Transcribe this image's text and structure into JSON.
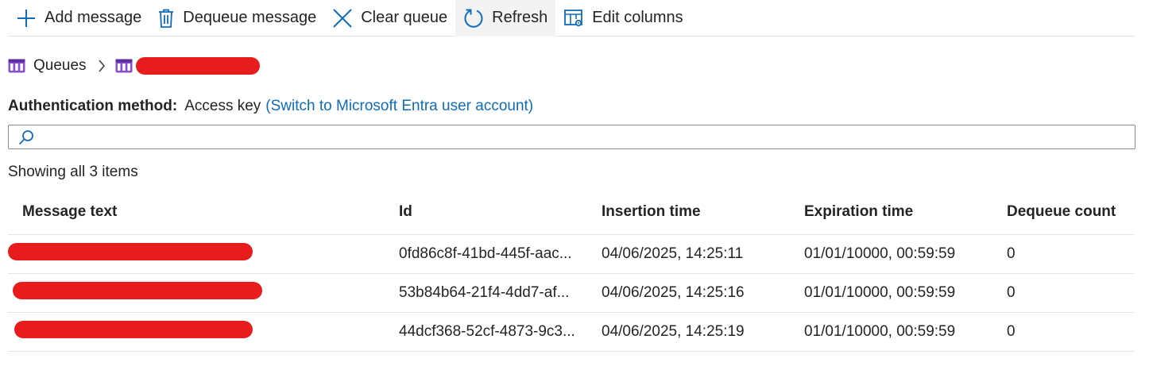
{
  "toolbar": {
    "add_message": "Add message",
    "dequeue_message": "Dequeue message",
    "clear_queue": "Clear queue",
    "refresh": "Refresh",
    "edit_columns": "Edit columns"
  },
  "breadcrumb": {
    "root": "Queues"
  },
  "auth": {
    "label": "Authentication method:",
    "value": "Access key",
    "switch_link": "(Switch to Microsoft Entra user account)"
  },
  "search": {
    "placeholder": ""
  },
  "status": {
    "count_text": "Showing all 3 items"
  },
  "table": {
    "columns": [
      "Message text",
      "Id",
      "Insertion time",
      "Expiration time",
      "Dequeue count"
    ],
    "rows": [
      {
        "id": "0fd86c8f-41bd-445f-aac...",
        "insertion_time": "04/06/2025, 14:25:11",
        "expiration_time": "01/01/10000, 00:59:59",
        "dequeue_count": "0"
      },
      {
        "id": "53b84b64-21f4-4dd7-af...",
        "insertion_time": "04/06/2025, 14:25:16",
        "expiration_time": "01/01/10000, 00:59:59",
        "dequeue_count": "0"
      },
      {
        "id": "44dcf368-52cf-4873-9c3...",
        "insertion_time": "04/06/2025, 14:25:19",
        "expiration_time": "01/01/10000, 00:59:59",
        "dequeue_count": "0"
      }
    ]
  },
  "icons": {
    "add": "plus-icon",
    "dequeue": "trash-icon",
    "clear": "close-icon",
    "refresh": "refresh-icon",
    "edit_columns": "table-settings-icon",
    "queue": "queue-icon",
    "search": "search-icon"
  },
  "colors": {
    "accent": "#0f6cbd",
    "queue_icon": "#8a4fd1",
    "redaction": "#e81c1c"
  }
}
